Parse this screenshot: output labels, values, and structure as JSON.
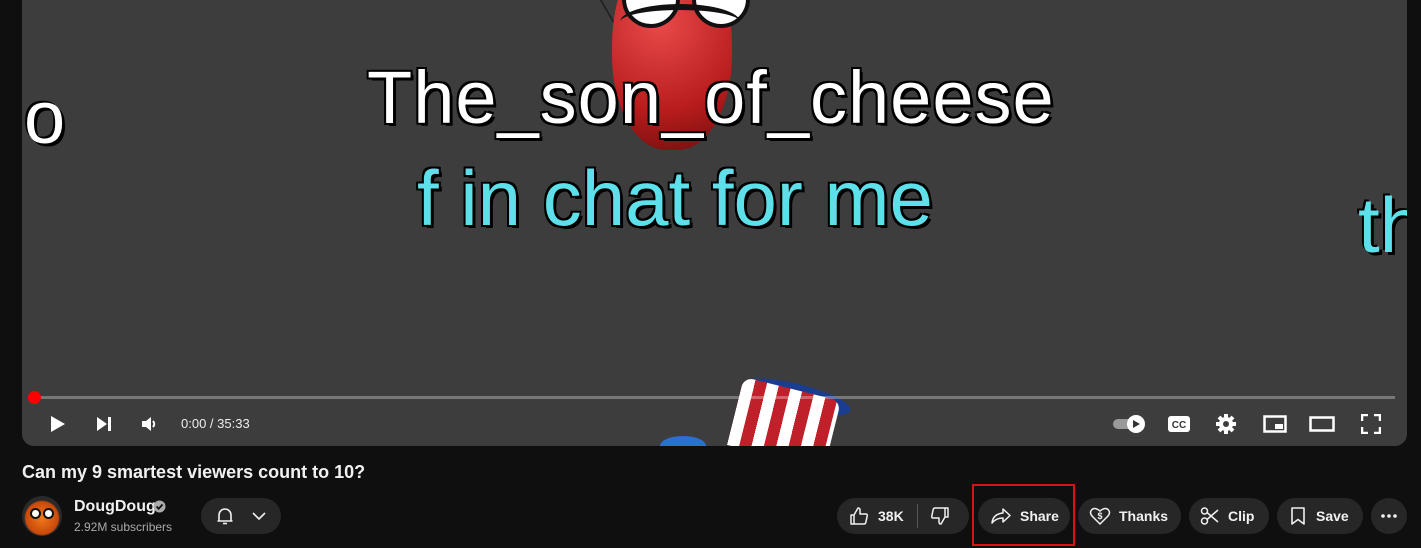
{
  "video": {
    "chat_name": "The_son_of_cheese",
    "chat_message": "f in chat for me",
    "side_left_text": "o",
    "side_right_text": "th",
    "time_current": "0:00",
    "time_total": "35:33",
    "time_display": "0:00 / 35:33",
    "progress_fraction": 0.0
  },
  "title": "Can my 9 smartest viewers count to 10?",
  "channel": {
    "name": "DougDoug",
    "subscribers": "2.92M subscribers",
    "verified": true
  },
  "actions": {
    "likes": "38K",
    "share": "Share",
    "thanks": "Thanks",
    "clip": "Clip",
    "save": "Save"
  },
  "colors": {
    "background": "#0f0f0f",
    "pill": "#272727",
    "progress_red": "#ff0000",
    "chat_cyan": "#5ee0ea",
    "highlight_box": "#e01010"
  },
  "icons": [
    "play-icon",
    "next-icon",
    "volume-icon",
    "autoplay-toggle-icon",
    "captions-icon",
    "settings-icon",
    "miniplayer-icon",
    "theater-icon",
    "fullscreen-icon",
    "bell-icon",
    "chevron-down-icon",
    "thumbs-up-icon",
    "thumbs-down-icon",
    "share-icon",
    "thanks-icon",
    "clip-icon",
    "save-icon",
    "more-icon",
    "verified-icon"
  ]
}
